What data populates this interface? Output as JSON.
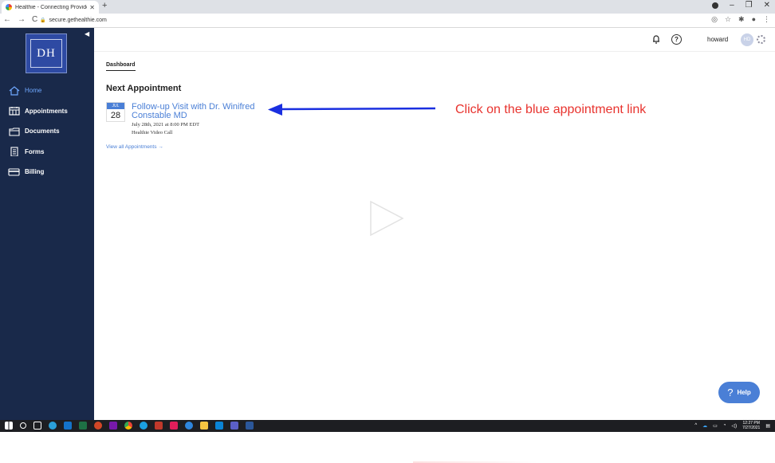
{
  "browser": {
    "tab_title": "Healthie - Connecting Providers",
    "tab_close": "✕",
    "new_tab": "+",
    "url": "secure.gethealthie.com"
  },
  "sidebar": {
    "logo_text": "DH",
    "items": [
      {
        "label": "Home",
        "icon": "home-icon",
        "active": true
      },
      {
        "label": "Appointments",
        "icon": "calendar-icon",
        "active": false
      },
      {
        "label": "Documents",
        "icon": "folder-icon",
        "active": false
      },
      {
        "label": "Forms",
        "icon": "clipboard-icon",
        "active": false
      },
      {
        "label": "Billing",
        "icon": "credit-card-icon",
        "active": false
      }
    ]
  },
  "header": {
    "username": "howard",
    "avatar_initials": "HD"
  },
  "main": {
    "breadcrumb": "Dashboard",
    "section_title": "Next Appointment",
    "appointment": {
      "month": "JUL",
      "day": "28",
      "title": "Follow-up Visit with Dr. Winifred Constable MD",
      "datetime": "July 28th, 2021 at 8:00 PM EDT",
      "location": "Healthie Video Call"
    },
    "view_all": "View all Appointments →"
  },
  "annotation": {
    "text": "Click on the blue appointment link",
    "color": "#e8332e",
    "arrow_color": "#1a2fe0"
  },
  "help_button": {
    "label": "Help",
    "glyph": "?"
  },
  "taskbar": {
    "time": "12:27 PM",
    "date": "7/27/2021"
  },
  "colors": {
    "sidebar_bg": "#19294a",
    "accent": "#4a7fd6",
    "logo_bg": "#2e4aa3"
  }
}
